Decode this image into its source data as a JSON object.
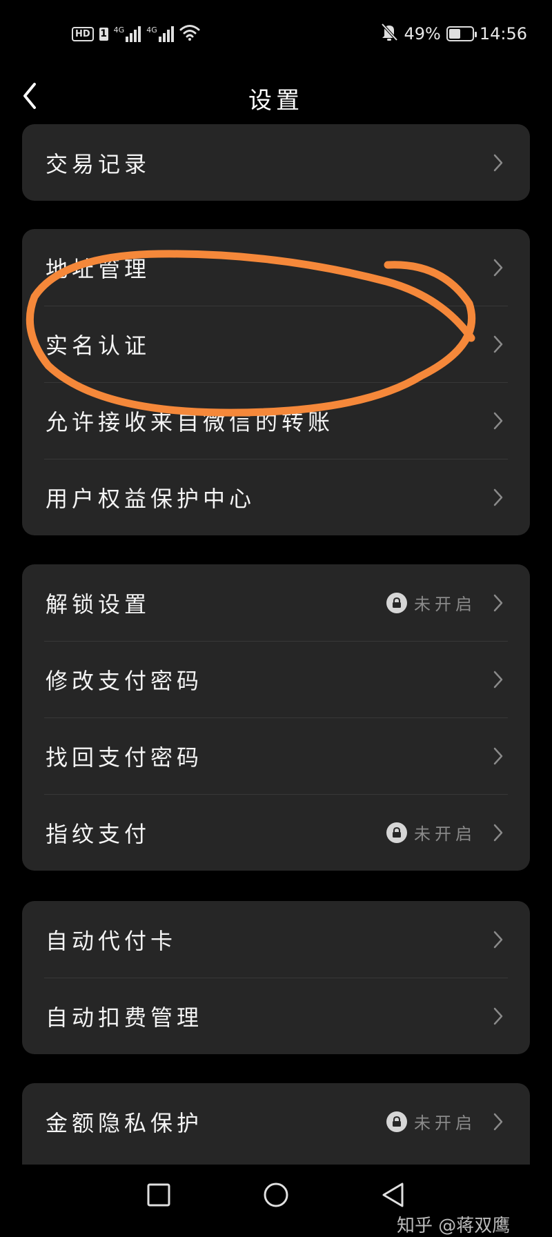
{
  "status_bar": {
    "hd_label": "HD",
    "sim_label": "1",
    "network_1": "4G",
    "network_2": "4G",
    "battery_percent": "49%",
    "battery_level": 0.49,
    "time": "14:56",
    "icons": [
      "wifi-icon",
      "bell-off-icon",
      "battery-icon"
    ]
  },
  "header": {
    "title": "设置",
    "back_icon": "chevron-left-icon"
  },
  "groups": [
    {
      "items": [
        {
          "label": "交易记录"
        }
      ]
    },
    {
      "items": [
        {
          "label": "地址管理"
        },
        {
          "label": "实名认证"
        },
        {
          "label": "允许接收来自微信的转账"
        },
        {
          "label": "用户权益保护中心"
        }
      ]
    },
    {
      "items": [
        {
          "label": "解锁设置",
          "status": "未开启"
        },
        {
          "label": "修改支付密码"
        },
        {
          "label": "找回支付密码"
        },
        {
          "label": "指纹支付",
          "status": "未开启"
        }
      ]
    },
    {
      "items": [
        {
          "label": "自动代付卡"
        },
        {
          "label": "自动扣费管理"
        }
      ]
    },
    {
      "items": [
        {
          "label": "金额隐私保护",
          "status": "未开启"
        }
      ]
    }
  ],
  "annotation": {
    "color": "#f5883a",
    "shape": "hand-drawn ellipse"
  },
  "navbar": {
    "icons": [
      "square-icon",
      "circle-icon",
      "triangle-back-icon"
    ]
  },
  "watermark": "知乎 @蒋双鹰"
}
